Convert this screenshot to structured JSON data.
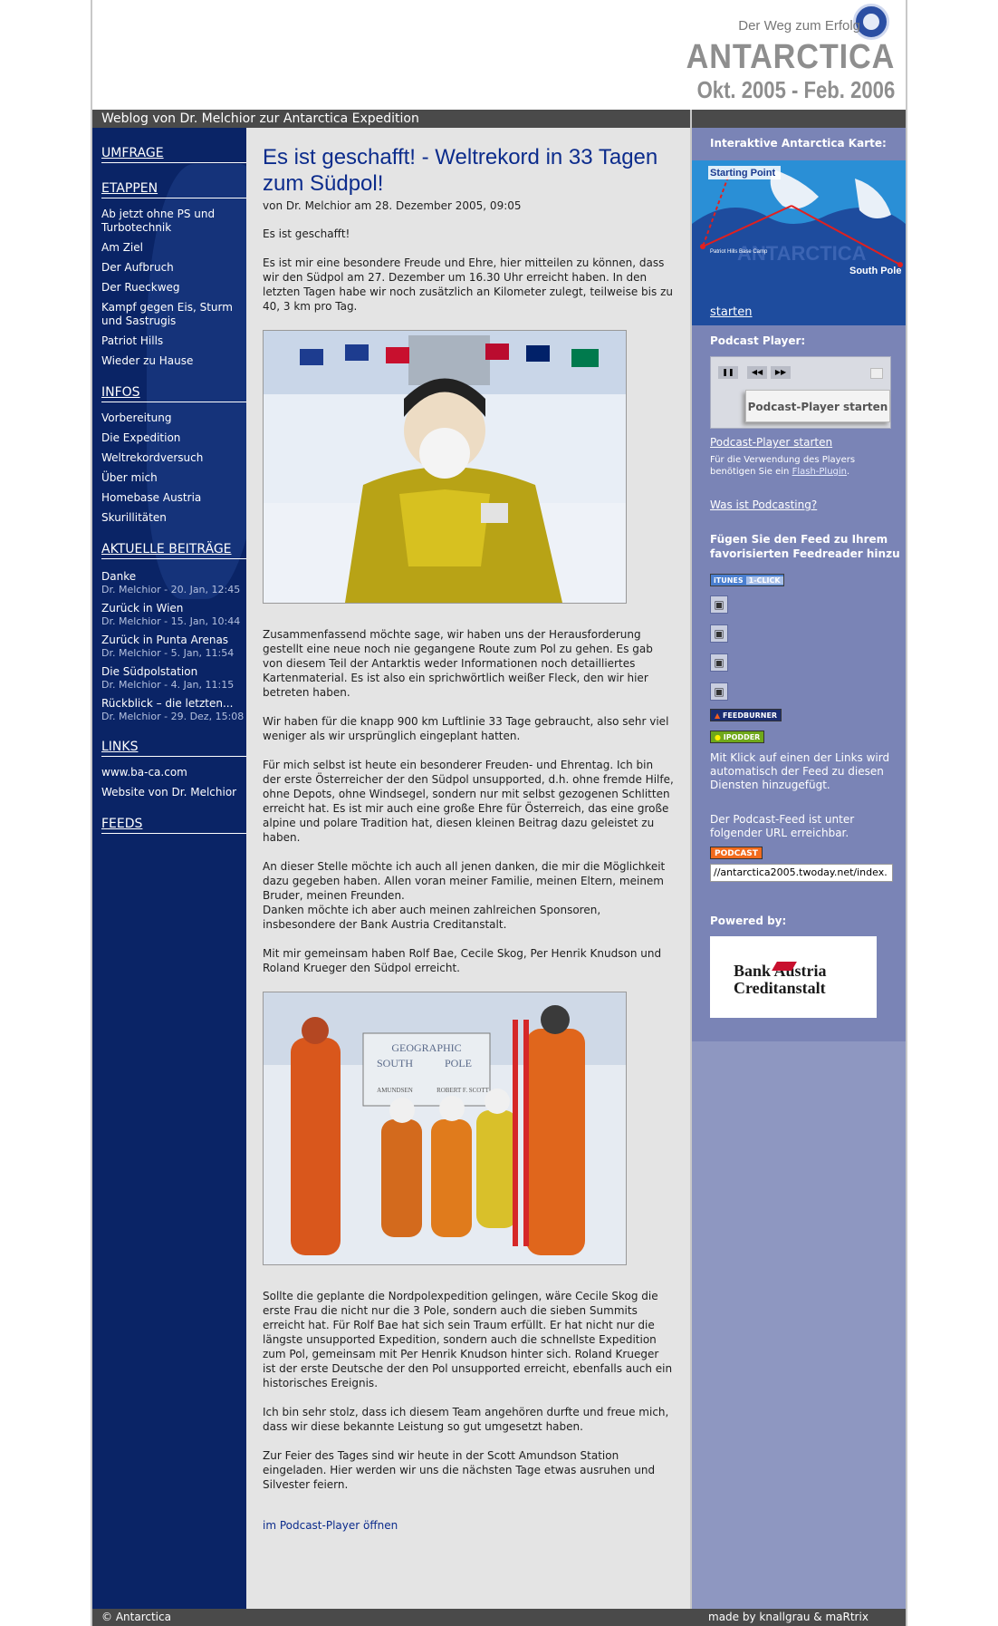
{
  "header": {
    "tagline": "Der Weg zum Erfolg",
    "title": "ANTARCTICA",
    "dates": "Okt. 2005 - Feb. 2006",
    "subtitle": "Weblog von Dr. Melchior zur Antarctica Expedition"
  },
  "sidebar": {
    "umfrage": "UMFRAGE",
    "etappen": "ETAPPEN",
    "etappen_items": [
      "Ab jetzt ohne PS und Turbotechnik",
      "Am Ziel",
      "Der Aufbruch",
      "Der Rueckweg",
      "Kampf gegen Eis, Sturm und Sastrugis",
      "Patriot Hills",
      "Wieder zu Hause"
    ],
    "infos": "INFOS",
    "infos_items": [
      "Vorbereitung",
      "Die Expedition",
      "Weltrekordversuch",
      "Über mich",
      "Homebase Austria",
      "Skurillitäten"
    ],
    "aktuelle": "AKTUELLE BEITRÄGE",
    "posts": [
      {
        "title": "Danke",
        "meta": "Dr. Melchior - 20. Jan, 12:45"
      },
      {
        "title": "Zurück in Wien",
        "meta": "Dr. Melchior - 15. Jan, 10:44"
      },
      {
        "title": "Zurück in Punta Arenas",
        "meta": "Dr. Melchior - 5. Jan, 11:54"
      },
      {
        "title": "Die Südpolstation",
        "meta": "Dr. Melchior - 4. Jan, 11:15"
      },
      {
        "title": "Rückblick – die letzten...",
        "meta": "Dr. Melchior - 29. Dez, 15:08"
      }
    ],
    "links": "LINKS",
    "links_items": [
      "www.ba-ca.com",
      "Website von Dr. Melchior"
    ],
    "feeds": "FEEDS"
  },
  "article": {
    "title": "Es ist geschafft! - Weltrekord in 33 Tagen zum Südpol!",
    "byline": "von Dr. Melchior am 28. Dezember 2005, 09:05",
    "p1": "Es ist geschafft!",
    "p2": "Es ist mir eine besondere Freude und Ehre, hier mitteilen zu können, dass wir den Südpol am 27. Dezember um 16.30 Uhr erreicht haben. In den letzten Tagen habe wir noch zusätzlich an Kilometer zulegt, teilweise bis zu 40, 3 km pro Tag.",
    "p3": "Zusammenfassend möchte sage, wir haben uns der Herausforderung gestellt eine neue noch nie gegangene Route zum Pol zu gehen. Es gab von diesem Teil der Antarktis weder Informationen noch detailliertes Kartenmaterial. Es ist also ein sprichwörtlich weißer Fleck, den wir hier betreten haben.",
    "p4": "Wir haben für die knapp 900 km Luftlinie 33 Tage gebraucht, also sehr viel weniger als wir ursprünglich eingeplant hatten.",
    "p5": "Für mich selbst ist heute ein besonderer Freuden- und Ehrentag. Ich bin der erste Österreicher der den Südpol unsupported, d.h. ohne fremde Hilfe, ohne Depots, ohne Windsegel, sondern nur mit selbst gezogenen Schlitten erreicht hat. Es ist mir auch eine große Ehre für Österreich, das eine große alpine und polare Tradition hat, diesen kleinen Beitrag dazu geleistet zu haben.",
    "p6a": "An dieser Stelle möchte ich auch all jenen danken, die mir die Möglichkeit dazu gegeben haben. Allen voran meiner Familie, meinen Eltern, meinem Bruder, meinen Freunden.",
    "p6b": "Danken möchte ich aber auch meinen zahlreichen Sponsoren, insbesondere der Bank Austria Creditanstalt.",
    "p7": "Mit mir gemeinsam haben Rolf Bae, Cecile Skog, Per Henrik Knudson und Roland Krueger den Südpol erreicht.",
    "sign_geographic": "GEOGRAPHIC",
    "sign_south": "SOUTH",
    "sign_pole": "POLE",
    "sign_amundsen": "AMUNDSEN",
    "sign_scott": "ROBERT F. SCOTT",
    "p8": "Sollte die geplante die Nordpolexpedition gelingen, wäre Cecile Skog die erste Frau die nicht nur die 3 Pole, sondern auch die sieben Summits erreicht hat. Für Rolf Bae hat sich sein Traum erfüllt. Er hat nicht nur die längste unsupported Expedition, sondern auch die schnellste Expedition zum Pol, gemeinsam mit Per Henrik Knudson hinter sich. Roland Krueger ist der erste Deutsche der den Pol unsupported erreicht, ebenfalls auch ein historisches Ereignis.",
    "p9": "Ich bin sehr stolz, dass ich diesem Team angehören durfte und freue mich, dass wir diese bekannte Leistung so gut umgesetzt haben.",
    "p10": "Zur Feier des Tages sind wir heute in der Scott Amundson Station eingeladen. Hier werden wir uns die nächsten Tage etwas ausruhen und Silvester feiern.",
    "podcast_link": "im Podcast-Player öffnen"
  },
  "right": {
    "map_title": "Interaktive Antarctica Karte:",
    "map_starting": "Starting Point",
    "map_south_pole": "South Pole",
    "map_watermark": "ANTARCTICA",
    "map_patriot": "Patriot Hills Base Camp",
    "map_start_link": "starten",
    "player_title": "Podcast Player:",
    "player_button": "Podcast-Player starten",
    "player_link": "Podcast-Player starten",
    "player_note_a": "Für die Verwendung des Players benötigen Sie ein ",
    "player_note_link": "Flash-Plugin",
    "player_note_b": ".",
    "what_is": "Was ist Podcasting?",
    "feed_title": "Fügen Sie den Feed zu Ihrem favorisierten Feedreader hinzu",
    "badge_itunes_a": "iTUNES",
    "badge_itunes_b": "1-CLICK",
    "badge_feedburner": "FEEDBURNER",
    "badge_ipodder": "IPODDER",
    "auto_text": "Mit Klick auf einen der Links wird automatisch der Feed zu diesen Diensten hinzugefügt.",
    "url_text": "Der Podcast-Feed ist unter folgender URL erreichbar.",
    "badge_podcast": "PODCAST",
    "feed_url": "//antarctica2005.twoday.net/index.",
    "powered": "Powered by:",
    "sponsor_line1": "Bank Austria",
    "sponsor_line2": "Creditanstalt"
  },
  "footer": {
    "left": "© Antarctica",
    "right": "made by knallgrau & maRtrix"
  }
}
